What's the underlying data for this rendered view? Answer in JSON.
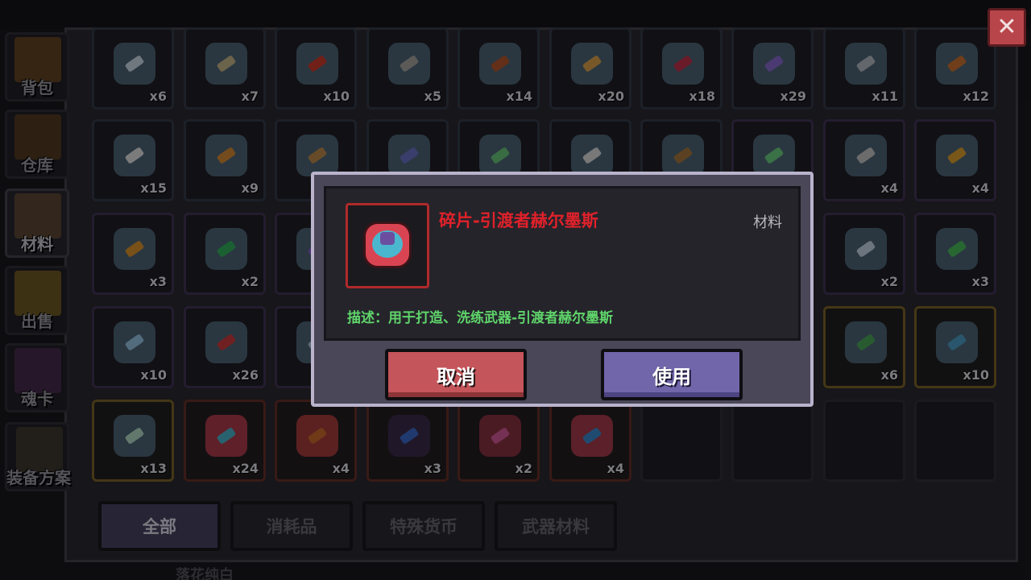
{
  "side_tabs": [
    {
      "label": "背包",
      "icon": "backpack-chest-icon"
    },
    {
      "label": "仓库",
      "icon": "warehouse-chest-icon"
    },
    {
      "label": "材料",
      "icon": "materials-box-icon"
    },
    {
      "label": "出售",
      "icon": "sell-bag-icon"
    },
    {
      "label": "魂卡",
      "icon": "soul-card-icon"
    },
    {
      "label": "装备方案",
      "icon": "equipment-plan-icon"
    }
  ],
  "grid": {
    "row1": [
      "x6",
      "x7",
      "x10",
      "x5",
      "x14",
      "x20",
      "x18",
      "x29",
      "x11",
      "x12"
    ],
    "row2": [
      "x15",
      "x9",
      "",
      "",
      "",
      "",
      "",
      "",
      "x4",
      "x4"
    ],
    "row3": [
      "x3",
      "x2",
      "",
      "",
      "",
      "",
      "",
      "",
      "x2",
      "x3"
    ],
    "row4": [
      "x10",
      "x26",
      "",
      "",
      "",
      "",
      "",
      "",
      "x6",
      "x10"
    ],
    "row5": [
      "x13",
      "x24",
      "x4",
      "x3",
      "x2",
      "x4",
      "",
      "",
      "",
      ""
    ]
  },
  "filter_tabs": [
    "全部",
    "消耗品",
    "特殊货币",
    "武器材料"
  ],
  "bottom_label": "落花纯白",
  "close": {
    "label": "✕",
    "icon": "close-icon"
  },
  "dialog": {
    "item_name": "碎片-引渡者赫尔墨斯",
    "item_type": "材料",
    "description": "描述：用于打造、洗练武器-引渡者赫尔墨斯",
    "cancel_label": "取消",
    "use_label": "使用",
    "item_icon": "hermes-fragment-icon"
  }
}
